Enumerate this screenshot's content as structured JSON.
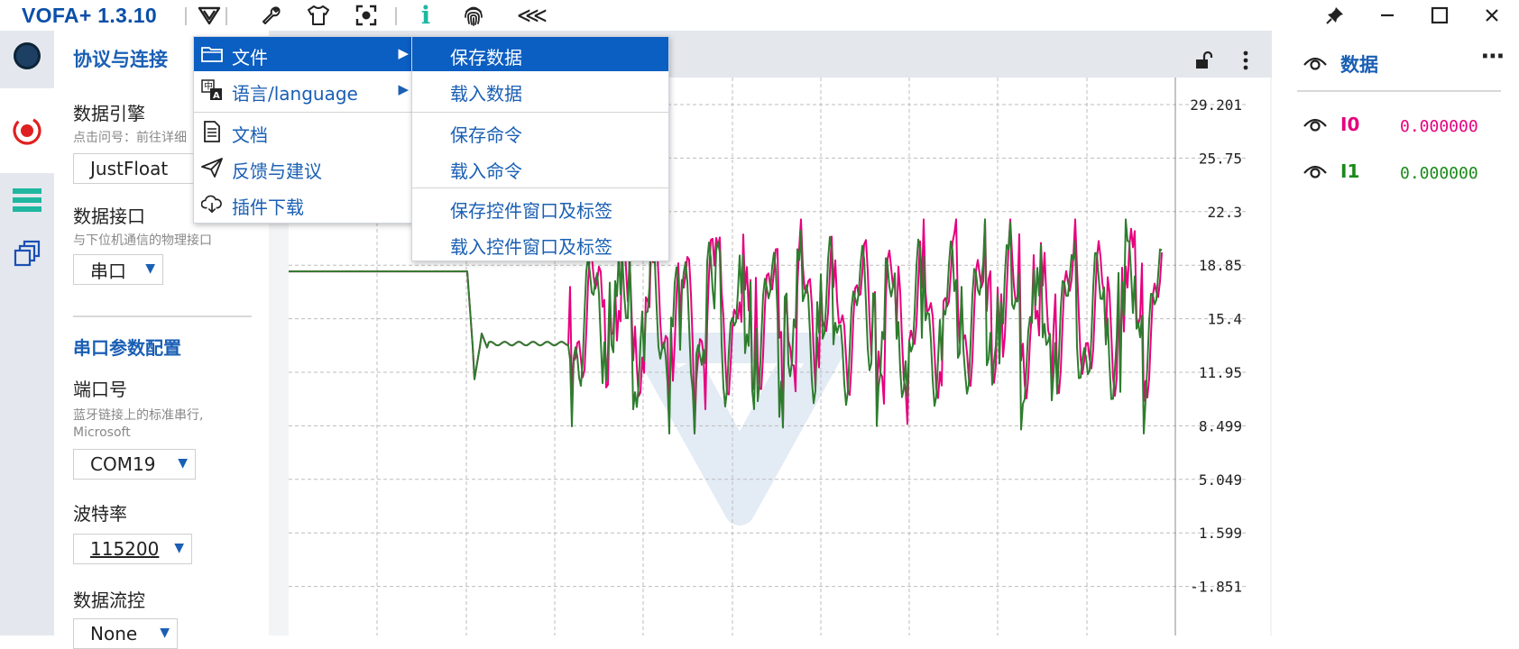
{
  "app": {
    "title": "VOFA+ 1.3.10"
  },
  "toolbar": {
    "icons": [
      "vofa-logo-icon",
      "wrench-icon",
      "shirt-icon",
      "focus-icon",
      "info-icon",
      "fingerprint-icon",
      "collapse-icon"
    ],
    "info_glyph": "i",
    "collapse_glyph": "⋘"
  },
  "window_controls": {
    "pin": "pin-icon",
    "minimize": "minimize-icon",
    "maximize": "maximize-icon",
    "close": "close-icon"
  },
  "sidebar": {
    "items": [
      {
        "name": "connect-status-icon"
      },
      {
        "name": "protocol-icon",
        "active": true
      },
      {
        "name": "widgets-icon"
      },
      {
        "name": "commands-icon"
      }
    ]
  },
  "panel": {
    "title": "协议与连接",
    "engine_label": "数据引擎",
    "engine_hint": "点击问号：前往详细",
    "engine_value": "JustFloat",
    "interface_label": "数据接口",
    "interface_hint": "与下位机通信的物理接口",
    "interface_value": "串口",
    "serial_section": "串口参数配置",
    "port_label": "端口号",
    "port_hint1": "蓝牙链接上的标准串行,",
    "port_hint2": "Microsoft",
    "port_value": "COM19",
    "baud_label": "波特率",
    "baud_value": "115200",
    "flow_label": "数据流控",
    "flow_value": "None",
    "dropdown_arrow": "▼"
  },
  "data_panel": {
    "title": "数据",
    "more": "⋯",
    "channels": [
      {
        "name": "I0",
        "value": "0.000000",
        "color": "#e6007e"
      },
      {
        "name": "I1",
        "value": "0.000000",
        "color": "#1a8a1a"
      }
    ]
  },
  "menu": {
    "items": [
      {
        "label": "文件",
        "icon": "folder-icon",
        "submenu": true,
        "highlight": true
      },
      {
        "label": "语言/language",
        "icon": "language-icon",
        "submenu": true
      },
      {
        "label": "文档",
        "icon": "document-icon"
      },
      {
        "label": "反馈与建议",
        "icon": "send-icon"
      },
      {
        "label": "插件下载",
        "icon": "cloud-download-icon"
      }
    ],
    "arrow": "▶"
  },
  "submenu": {
    "items": [
      {
        "label": "保存数据",
        "highlight": true
      },
      {
        "label": "载入数据"
      },
      {
        "label": "保存命令"
      },
      {
        "label": "载入命令"
      },
      {
        "label": "保存控件窗口及标签"
      },
      {
        "label": "载入控件窗口及标签"
      }
    ]
  },
  "chart_data": {
    "type": "line",
    "title": "",
    "xlabel": "",
    "ylabel": "",
    "ylim": [
      -5.301,
      29.201
    ],
    "yticks": [
      "29.201",
      "25.75",
      "22.3",
      "18.85",
      "15.4",
      "11.95",
      "8.499",
      "5.049",
      "1.599",
      "-1.851"
    ],
    "grid": true,
    "series": [
      {
        "color": "#e6007e"
      },
      {
        "color": "#2e7d2e"
      }
    ]
  }
}
